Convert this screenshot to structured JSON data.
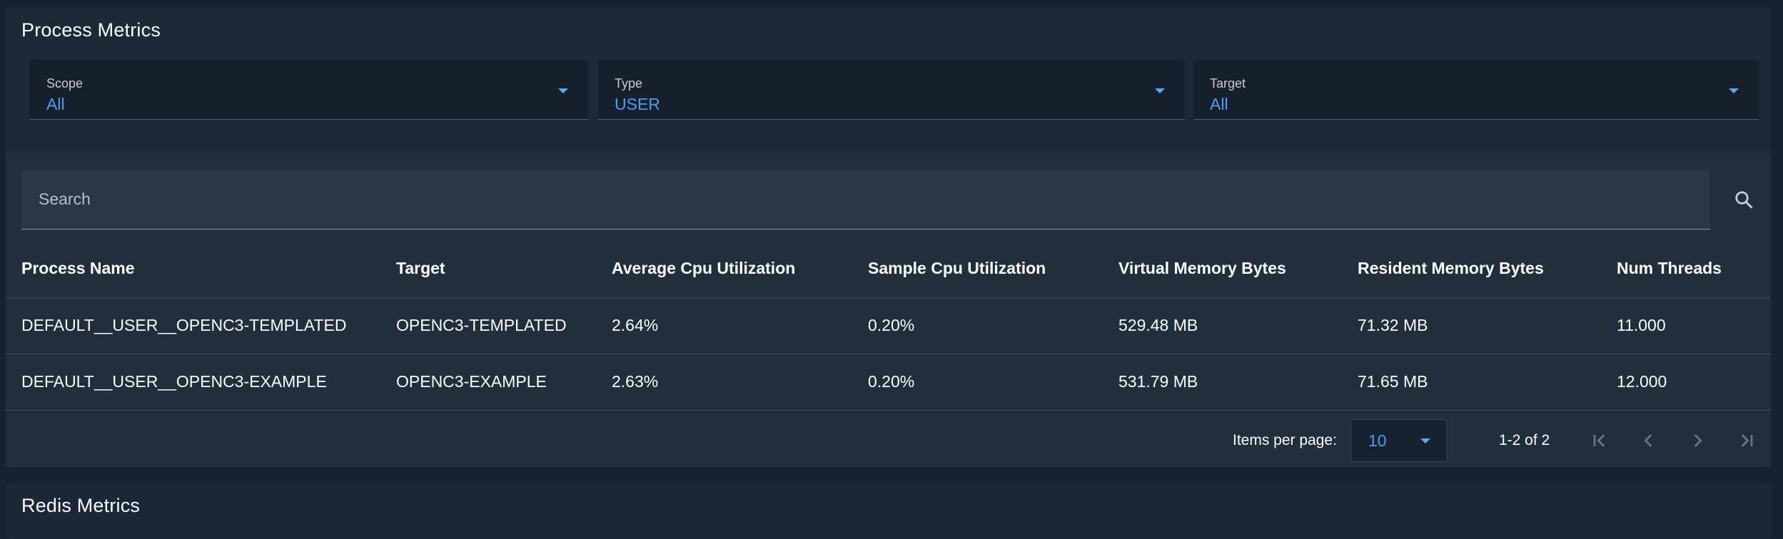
{
  "process_metrics": {
    "title": "Process Metrics",
    "filters": {
      "scope": {
        "label": "Scope",
        "value": "All"
      },
      "type": {
        "label": "Type",
        "value": "USER"
      },
      "target": {
        "label": "Target",
        "value": "All"
      }
    },
    "search": {
      "placeholder": "Search",
      "value": ""
    },
    "table": {
      "columns": [
        "Process Name",
        "Target",
        "Average Cpu Utilization",
        "Sample Cpu Utilization",
        "Virtual Memory Bytes",
        "Resident Memory Bytes",
        "Num Threads"
      ],
      "rows": [
        [
          "DEFAULT__USER__OPENC3-TEMPLATED",
          "OPENC3-TEMPLATED",
          "2.64%",
          "0.20%",
          "529.48 MB",
          "71.32 MB",
          "11.000"
        ],
        [
          "DEFAULT__USER__OPENC3-EXAMPLE",
          "OPENC3-EXAMPLE",
          "2.63%",
          "0.20%",
          "531.79 MB",
          "71.65 MB",
          "12.000"
        ]
      ]
    },
    "pagination": {
      "items_per_page_label": "Items per page:",
      "items_per_page": "10",
      "range": "1-2 of 2"
    }
  },
  "redis_metrics": {
    "title": "Redis Metrics"
  },
  "colors": {
    "background": "#172230",
    "card": "#1d2938",
    "accent": "#4a9ff0",
    "text": "#ffffff",
    "muted_icon": "#6b7684"
  },
  "icons": [
    "chevron-down-icon",
    "search-icon",
    "first-page-icon",
    "previous-page-icon",
    "next-page-icon",
    "last-page-icon"
  ]
}
